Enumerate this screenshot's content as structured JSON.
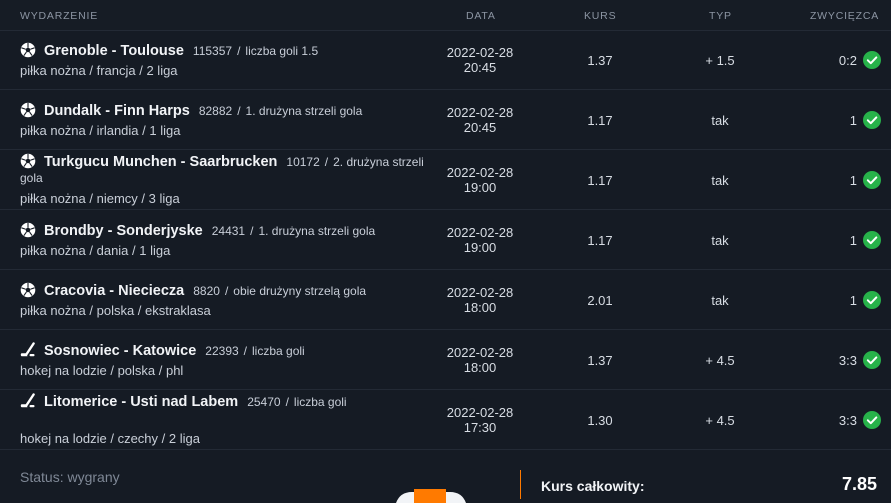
{
  "header": {
    "event": "WYDARZENIE",
    "date": "DATA",
    "odds": "KURS",
    "type": "TYP",
    "winner": "ZWYCIĘZCA"
  },
  "rows": [
    {
      "sport_icon": "soccer-ball-icon",
      "match": "Grenoble - Toulouse",
      "id": "115357",
      "market": "liczba goli 1.5",
      "path": "piłka nożna / francja / 2 liga",
      "date": "2022-02-28",
      "time": "20:45",
      "odds": "1.37",
      "type": "+ 1.5",
      "result": "0:2",
      "status_icon": "check-circle-icon"
    },
    {
      "sport_icon": "soccer-ball-icon",
      "match": "Dundalk - Finn Harps",
      "id": "82882",
      "market": "1. drużyna strzeli gola",
      "path": "piłka nożna / irlandia / 1 liga",
      "date": "2022-02-28",
      "time": "20:45",
      "odds": "1.17",
      "type": "tak",
      "result": "1",
      "status_icon": "check-circle-icon"
    },
    {
      "sport_icon": "soccer-ball-icon",
      "match": "Turkgucu Munchen - Saarbrucken",
      "id": "10172",
      "market": "2. drużyna strzeli gola",
      "path": "piłka nożna / niemcy / 3 liga",
      "date": "2022-02-28",
      "time": "19:00",
      "odds": "1.17",
      "type": "tak",
      "result": "1",
      "status_icon": "check-circle-icon"
    },
    {
      "sport_icon": "soccer-ball-icon",
      "match": "Brondby - Sonderjyske",
      "id": "24431",
      "market": "1. drużyna strzeli gola",
      "path": "piłka nożna / dania / 1 liga",
      "date": "2022-02-28",
      "time": "19:00",
      "odds": "1.17",
      "type": "tak",
      "result": "1",
      "status_icon": "check-circle-icon"
    },
    {
      "sport_icon": "soccer-ball-icon",
      "match": "Cracovia - Nieciecza",
      "id": "8820",
      "market": "obie drużyny strzelą gola",
      "path": "piłka nożna / polska / ekstraklasa",
      "date": "2022-02-28",
      "time": "18:00",
      "odds": "2.01",
      "type": "tak",
      "result": "1",
      "status_icon": "check-circle-icon"
    },
    {
      "sport_icon": "hockey-stick-icon",
      "match": "Sosnowiec - Katowice",
      "id": "22393",
      "market": "liczba goli",
      "path": "hokej na lodzie / polska / phl",
      "date": "2022-02-28",
      "time": "18:00",
      "odds": "1.37",
      "type": "+ 4.5",
      "result": "3:3",
      "status_icon": "check-circle-icon"
    },
    {
      "sport_icon": "hockey-stick-icon",
      "match": "Litomerice - Usti nad Labem",
      "id": "25470",
      "market": "liczba goli",
      "path": "hokej na lodzie / czechy / 2 liga",
      "date": "2022-02-28",
      "time": "17:30",
      "odds": "1.30",
      "type": "+ 4.5",
      "result": "3:3",
      "status_icon": "check-circle-icon"
    }
  ],
  "footer": {
    "status": "Status: wygrany",
    "total_label": "Kurs całkowity:",
    "total_value": "7.85"
  },
  "colors": {
    "background": "#151b24",
    "row_border": "#232a35",
    "win_green": "#27b24a",
    "accent_orange": "#ff7a00"
  }
}
